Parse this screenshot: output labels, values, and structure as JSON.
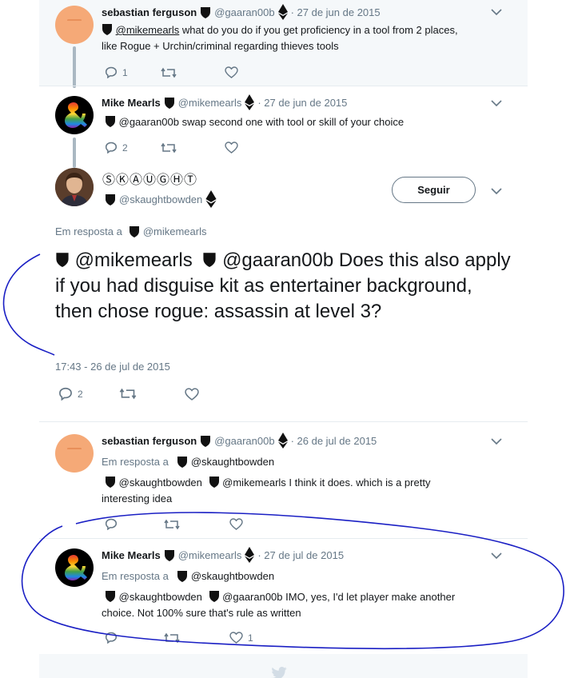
{
  "colors": {
    "thread_line": "#aab8c2",
    "muted_text": "#657786",
    "highlight_bg": "#f5f8fa",
    "annotation_ink": "#1a1fc4",
    "twitter_blue": "#1da1f2"
  },
  "tweet1": {
    "name": "sebastian ferguson",
    "handle": "@gaaran00b",
    "time": "· 27 de jun de 2015",
    "mention": "@mikemearls",
    "text_line1": " what do you do if you get proficiency in a tool from 2 places,",
    "text_line2": "like Rogue + Urchin/criminal regarding thieves tools",
    "reply_count": "1",
    "avatar_icon": "egg-avatar"
  },
  "tweet2": {
    "name": "Mike Mearls",
    "handle": "@mikemearls",
    "time": "· 27 de jun de 2015",
    "text": "@gaaran00b swap second one with tool or skill of your choice",
    "reply_count": "2",
    "avatar_icon": "dnd-ampersand-avatar"
  },
  "main_tweet": {
    "name": "ⓈⓀⒶⓊⒼⒽⓉ",
    "handle": "@skaughtbowden",
    "follow_label": "Seguir",
    "reply_prefix": "Em resposta a",
    "reply_to": "@mikemearls",
    "text_m1": "@mikemearls",
    "text_m2": "@gaaran00b",
    "text_rest": " Does this also apply if you had disguise kit as entertainer background, then chose rogue: assassin at level 3?",
    "timestamp": "17:43 - 26 de jul de 2015",
    "reply_count": "2"
  },
  "tweet4": {
    "name": "sebastian ferguson",
    "handle": "@gaaran00b",
    "time": "· 26 de jul de 2015",
    "reply_prefix": "Em resposta a",
    "reply_to": "@skaughtbowden",
    "mention1": "@skaughtbowden",
    "mention2": "@mikemearls",
    "text_line1": " I think it does. which is a pretty",
    "text_line2": "interesting idea"
  },
  "tweet5": {
    "name": "Mike Mearls",
    "handle": "@mikemearls",
    "time": "· 27 de jul de 2015",
    "reply_prefix": "Em resposta a",
    "reply_to": "@skaughtbowden",
    "mention1": "@skaughtbowden",
    "mention2": "@gaaran00b",
    "text_line1": " IMO, yes, I'd let player make another",
    "text_line2": "choice. Not 100% sure that's rule as written",
    "like_count": "1"
  }
}
